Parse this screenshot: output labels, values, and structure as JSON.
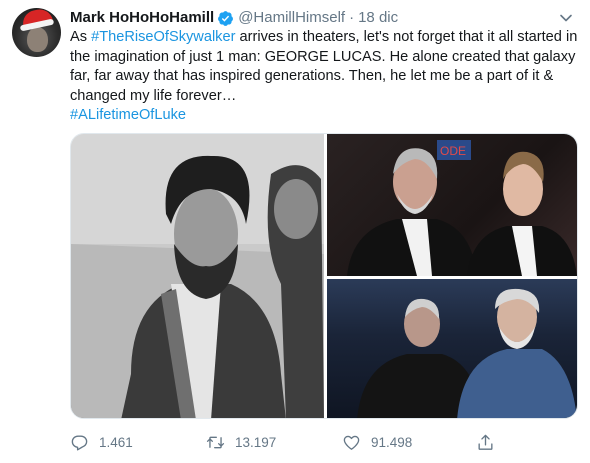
{
  "tweet": {
    "author_name": "Mark HoHoHoHamill",
    "handle": "@HamillHimself",
    "separator": "·",
    "date": "18 dic",
    "text_part_1": "As ",
    "hashtag_1": "#TheRiseOfSkywalker",
    "text_part_2": " arrives in theaters, let's not forget that it all started in the imagination of just 1 man: GEORGE LUCAS. He alone created that galaxy far, far away that has inspired generations. Then, he let me be a part of it & changed my life forever…",
    "hashtag_2": "#ALifetimeOfLuke"
  },
  "media": {
    "photo_3_sign": "ODE"
  },
  "actions": {
    "reply_count": "1.461",
    "retweet_count": "13.197",
    "like_count": "91.498"
  },
  "colors": {
    "link": "#1b95e0",
    "verified": "#1da1f2",
    "muted": "#657786"
  },
  "icons": [
    "verified-badge-icon",
    "chevron-down-icon",
    "reply-icon",
    "retweet-icon",
    "like-icon",
    "share-icon"
  ]
}
